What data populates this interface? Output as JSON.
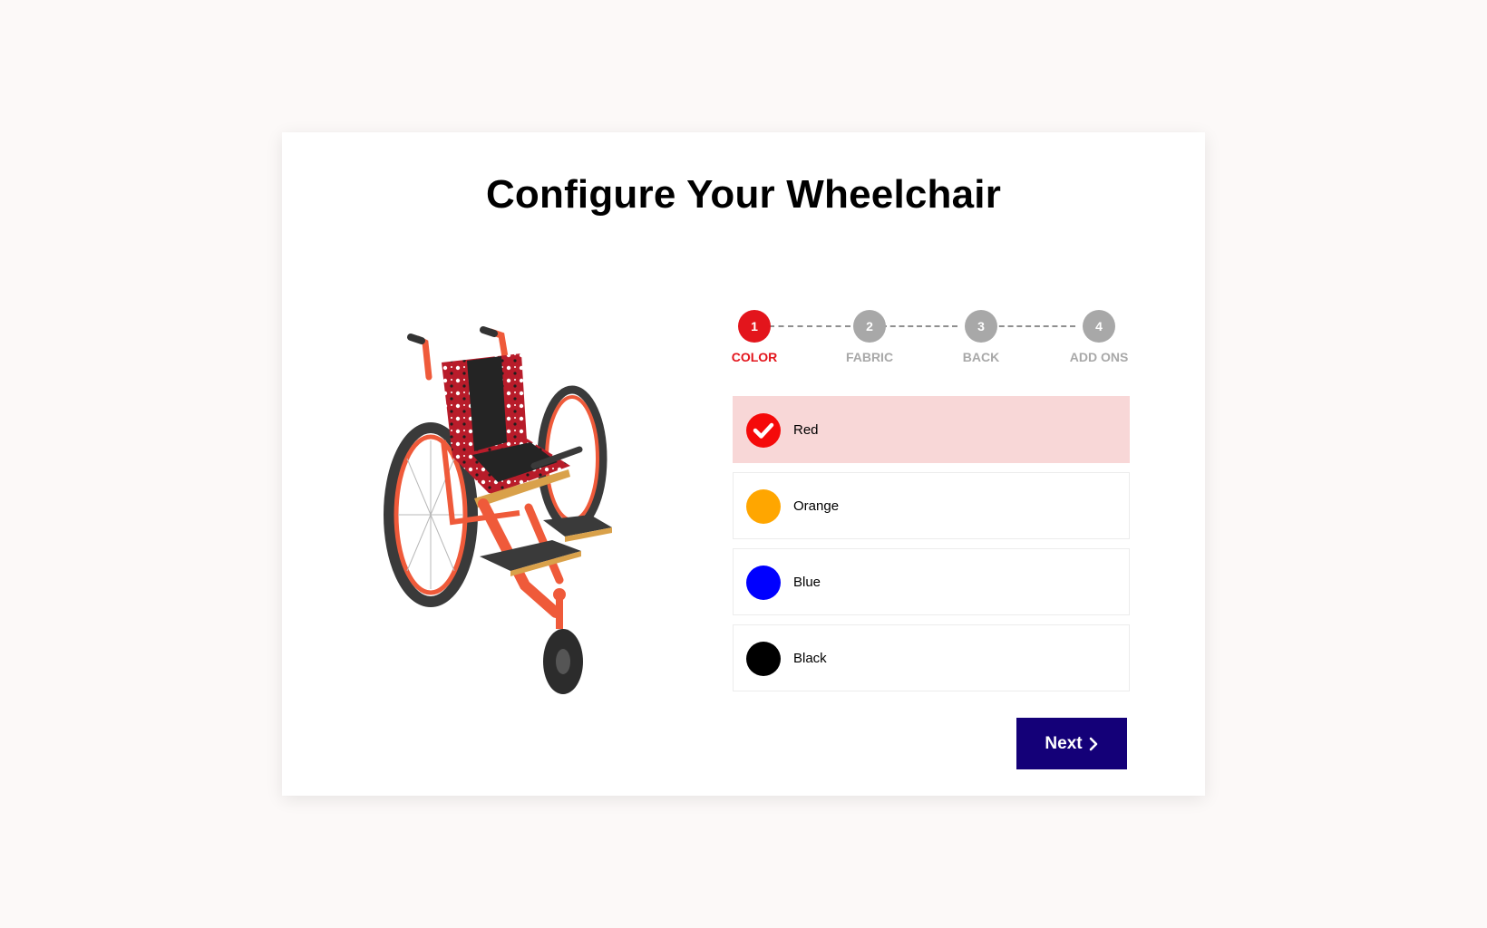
{
  "page": {
    "title": "Configure Your Wheelchair"
  },
  "product": {
    "image_name": "wheelchair-product-image"
  },
  "stepper": {
    "steps": [
      {
        "number": "1",
        "label": "COLOR",
        "active": true
      },
      {
        "number": "2",
        "label": "FABRIC",
        "active": false
      },
      {
        "number": "3",
        "label": "BACK",
        "active": false
      },
      {
        "number": "4",
        "label": "ADD ONS",
        "active": false
      }
    ],
    "active_color": "#e3151c",
    "inactive_color": "#a8a8a8"
  },
  "colors": {
    "selected": "Red",
    "options": [
      {
        "label": "Red",
        "swatch": "#f50a0a",
        "selected": true,
        "icon": "check-icon"
      },
      {
        "label": "Orange",
        "swatch": "#ffa600",
        "selected": false
      },
      {
        "label": "Blue",
        "swatch": "#0000ff",
        "selected": false
      },
      {
        "label": "Black",
        "swatch": "#000000",
        "selected": false
      }
    ],
    "selected_background": "#f8d7d7"
  },
  "actions": {
    "next_label": "Next",
    "next_icon": "chevron-right-icon",
    "next_color": "#140078"
  }
}
